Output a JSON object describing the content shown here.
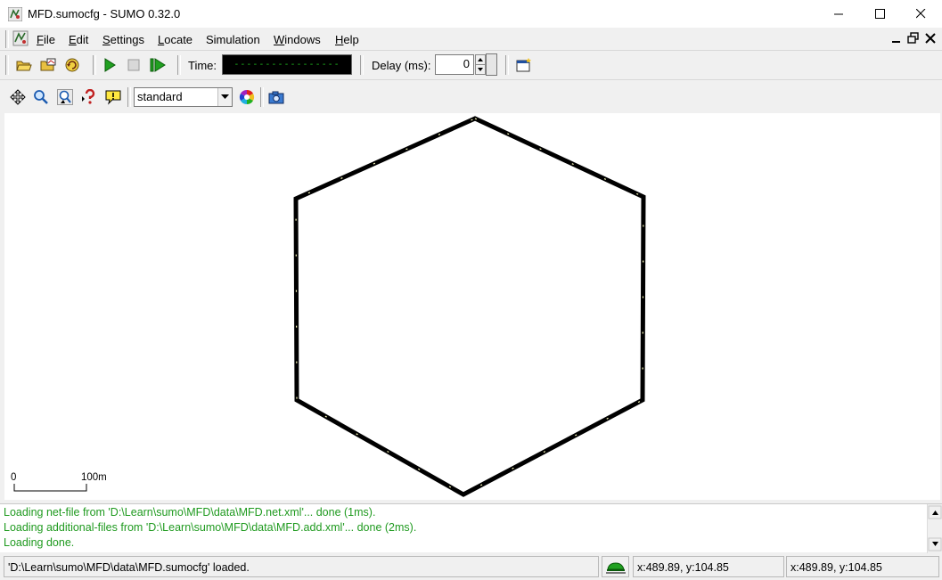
{
  "window": {
    "title": "MFD.sumocfg - SUMO 0.32.0"
  },
  "menu": {
    "items": [
      {
        "label": "File",
        "mnemonic": "F",
        "rest": "ile"
      },
      {
        "label": "Edit",
        "mnemonic": "E",
        "rest": "dit"
      },
      {
        "label": "Settings",
        "mnemonic": "S",
        "rest": "ettings"
      },
      {
        "label": "Locate",
        "mnemonic": "L",
        "rest": "ocate"
      },
      {
        "label": "Simulation",
        "mnemonic": "",
        "rest": "Simulation"
      },
      {
        "label": "Windows",
        "mnemonic": "W",
        "rest": "indows"
      },
      {
        "label": "Help",
        "mnemonic": "H",
        "rest": "elp"
      }
    ]
  },
  "toolbar": {
    "time_label": "Time:",
    "time_value": "-----------------",
    "delay_label": "Delay (ms):",
    "delay_value": "0"
  },
  "view_toolbar": {
    "scheme_value": "standard"
  },
  "canvas": {
    "scale_start": "0",
    "scale_end": "100m"
  },
  "log": {
    "lines": [
      "Loading net-file from 'D:\\Learn\\sumo\\MFD\\data\\MFD.net.xml'... done (1ms).",
      "Loading additional-files from 'D:\\Learn\\sumo\\MFD\\data\\MFD.add.xml'... done (2ms).",
      "Loading done."
    ]
  },
  "status": {
    "message": "'D:\\Learn\\sumo\\MFD\\data\\MFD.sumocfg' loaded.",
    "coord1": "x:489.89, y:104.85",
    "coord2": "x:489.89, y:104.85"
  }
}
